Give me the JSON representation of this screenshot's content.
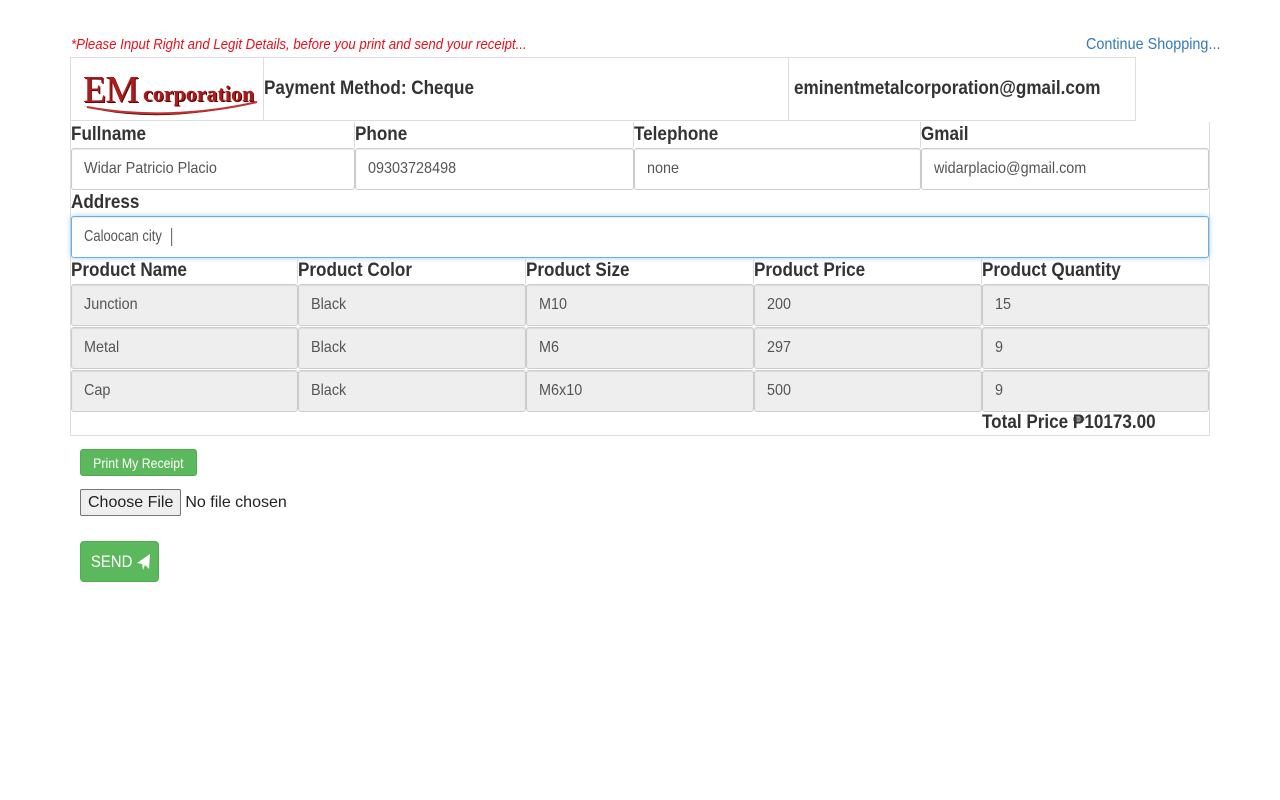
{
  "notice": "*Please Input Right and Legit Details, before you print and send your receipt...",
  "continue_link": "Continue Shopping...",
  "header": {
    "logo_em": "EM",
    "logo_corp": "corporation",
    "payment_method": "Payment Method: Cheque",
    "company_email": "eminentmetalcorporation@gmail.com"
  },
  "customer": {
    "labels": {
      "fullname": "Fullname",
      "phone": "Phone",
      "telephone": "Telephone",
      "gmail": "Gmail",
      "address": "Address"
    },
    "fullname": "Widar Patricio Placio",
    "phone": "09303728498",
    "telephone": "none",
    "gmail": "widarplacio@gmail.com",
    "address": "Caloocan city"
  },
  "products": {
    "headers": [
      "Product Name",
      "Product Color",
      "Product Size",
      "Product Price",
      "Product Quantity"
    ],
    "rows": [
      [
        "Junction",
        "Black",
        "M10",
        "200",
        "15"
      ],
      [
        "Metal",
        "Black",
        "M6",
        "297",
        "9"
      ],
      [
        "Cap",
        "Black",
        "M6x10",
        "500",
        "9"
      ]
    ]
  },
  "total_price": "Total Price ₱10173.00",
  "buttons": {
    "print": "Print My Receipt",
    "choose_file": "Choose File",
    "no_file": "No file chosen",
    "send": "SEND"
  },
  "colors": {
    "notice": "#e8111b",
    "link": "#337ab7",
    "success": "#5cb85c",
    "focus": "#66afe9",
    "logo": "#b11a1a"
  },
  "icons": {
    "send": "paper-plane-icon"
  }
}
